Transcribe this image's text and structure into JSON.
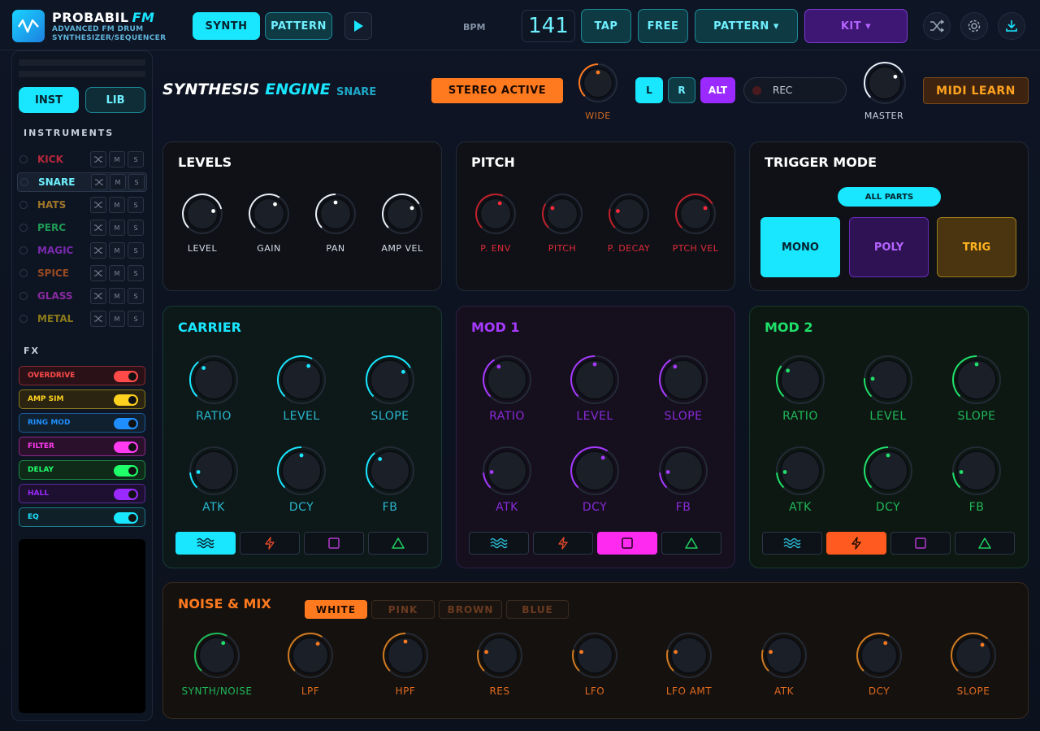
{
  "brand": {
    "name": "PROBABIL",
    "name_suffix": "FM",
    "subtitle_1": "ADVANCED FM DRUM",
    "subtitle_2": "SYNTHESIZER/SEQUENCER"
  },
  "topbar": {
    "synth_label": "SYNTH",
    "pattern_label": "PATTERN",
    "bpm_label": "BPM",
    "bpm_value": "141",
    "tap_label": "TAP",
    "free_label": "FREE",
    "pattern_menu_label": "PATTERN ▾",
    "kit_menu_label": "KIT ▾"
  },
  "sidebar": {
    "inst_tab": "INST",
    "lib_tab": "LIB",
    "instruments_title": "INSTRUMENTS",
    "instruments": [
      {
        "name": "KICK",
        "color": "#b5283a"
      },
      {
        "name": "SNARE",
        "color": "#6ff0ff"
      },
      {
        "name": "HATS",
        "color": "#a0762a"
      },
      {
        "name": "PERC",
        "color": "#1e9a55"
      },
      {
        "name": "MAGIC",
        "color": "#7a2aaf"
      },
      {
        "name": "SPICE",
        "color": "#9a4a20"
      },
      {
        "name": "GLASS",
        "color": "#8a2aa0"
      },
      {
        "name": "METAL",
        "color": "#8a7a1a"
      }
    ],
    "mini_m": "M",
    "mini_s": "S",
    "fx_title": "FX",
    "fx": [
      {
        "name": "OVERDRIVE",
        "color": "#ff4a4a",
        "bg": "#2a1118",
        "border": "#8a2a33"
      },
      {
        "name": "AMP SIM",
        "color": "#ffd21f",
        "bg": "#2a2410",
        "border": "#8a7a1c"
      },
      {
        "name": "RING MOD",
        "color": "#1f8fff",
        "bg": "#10202f",
        "border": "#1c5a99"
      },
      {
        "name": "FILTER",
        "color": "#ff3af0",
        "bg": "#2a102a",
        "border": "#8a2a8a"
      },
      {
        "name": "DELAY",
        "color": "#1fff6a",
        "bg": "#102a1a",
        "border": "#1c8a44"
      },
      {
        "name": "HALL",
        "color": "#9a2aff",
        "bg": "#1e1030",
        "border": "#5a2a9a"
      },
      {
        "name": "EQ",
        "color": "#19e6ff",
        "bg": "#102028",
        "border": "#1c7a8a"
      }
    ]
  },
  "header": {
    "title_a": "SYNTHESIS",
    "title_b": "ENGINE",
    "instrument": "SNARE",
    "stereo_label": "STEREO ACTIVE",
    "wide_label": "WIDE",
    "l_label": "L",
    "r_label": "R",
    "alt_label": "ALT",
    "rec_label": "REC",
    "master_label": "MASTER",
    "midi_label": "MIDI LEARN"
  },
  "levels": {
    "title": "LEVELS",
    "knobs": [
      {
        "label": "LEVEL",
        "v": 0.78
      },
      {
        "label": "GAIN",
        "v": 0.62
      },
      {
        "label": "PAN",
        "v": 0.5
      },
      {
        "label": "AMP VEL",
        "v": 0.72
      }
    ]
  },
  "pitch": {
    "title": "PITCH",
    "knobs": [
      {
        "label": "P. ENV",
        "v": 0.58
      },
      {
        "label": "PITCH",
        "v": 0.28
      },
      {
        "label": "P. DECAY",
        "v": 0.22
      },
      {
        "label": "PTCH VEL",
        "v": 0.72
      }
    ]
  },
  "trigger": {
    "title": "TRIGGER MODE",
    "all_parts": "ALL PARTS",
    "mono": "MONO",
    "poly": "POLY",
    "trig": "TRIG"
  },
  "carrier": {
    "title": "CARRIER",
    "knobs": [
      {
        "label": "RATIO",
        "v": 0.35
      },
      {
        "label": "LEVEL",
        "v": 0.6
      },
      {
        "label": "SLOPE",
        "v": 0.72
      },
      {
        "label": "ATK",
        "v": 0.15
      },
      {
        "label": "DCY",
        "v": 0.5
      },
      {
        "label": "FB",
        "v": 0.35
      }
    ]
  },
  "mod1": {
    "title": "MOD 1",
    "knobs": [
      {
        "label": "RATIO",
        "v": 0.38
      },
      {
        "label": "LEVEL",
        "v": 0.5
      },
      {
        "label": "SLOPE",
        "v": 0.38
      },
      {
        "label": "ATK",
        "v": 0.15
      },
      {
        "label": "DCY",
        "v": 0.62
      },
      {
        "label": "FB",
        "v": 0.15
      }
    ]
  },
  "mod2": {
    "title": "MOD 2",
    "knobs": [
      {
        "label": "RATIO",
        "v": 0.3
      },
      {
        "label": "LEVEL",
        "v": 0.18
      },
      {
        "label": "SLOPE",
        "v": 0.5
      },
      {
        "label": "ATK",
        "v": 0.15
      },
      {
        "label": "DCY",
        "v": 0.5
      },
      {
        "label": "FB",
        "v": 0.15
      }
    ]
  },
  "noise": {
    "title": "NOISE & MIX",
    "types": [
      "WHITE",
      "PINK",
      "BROWN",
      "BLUE"
    ],
    "knobs": [
      {
        "label": "SYNTH/NOISE",
        "v": 0.6
      },
      {
        "label": "LPF",
        "v": 0.62
      },
      {
        "label": "HPF",
        "v": 0.5
      },
      {
        "label": "RES",
        "v": 0.22
      },
      {
        "label": "LFO",
        "v": 0.22
      },
      {
        "label": "LFO AMT",
        "v": 0.22
      },
      {
        "label": "ATK",
        "v": 0.22
      },
      {
        "label": "DCY",
        "v": 0.6
      },
      {
        "label": "SLOPE",
        "v": 0.65
      }
    ]
  },
  "colors": {
    "cyan": "#19e6ff",
    "purple": "#9a2aff",
    "green": "#1fe06a",
    "orange": "#ff7a1f",
    "red": "#ff2a3a",
    "white": "#e8eef5"
  }
}
